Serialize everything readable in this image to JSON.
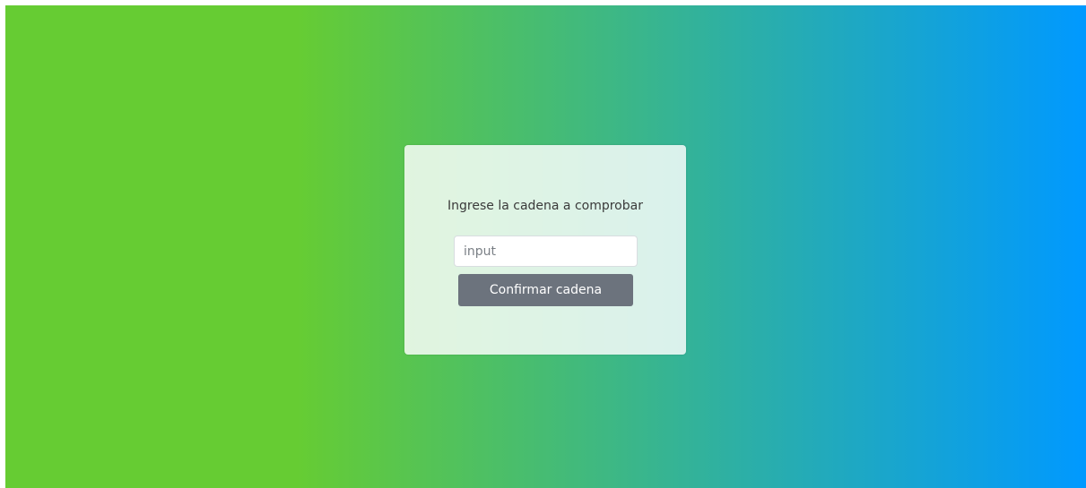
{
  "page": {
    "background_gradient": [
      "#66cc33",
      "#0099ff"
    ]
  },
  "form": {
    "prompt": "Ingrese la cadena a comprobar",
    "input": {
      "placeholder": "input",
      "value": ""
    },
    "confirm_button_label": "Confirmar cadena",
    "button_color": "#6c737d"
  }
}
